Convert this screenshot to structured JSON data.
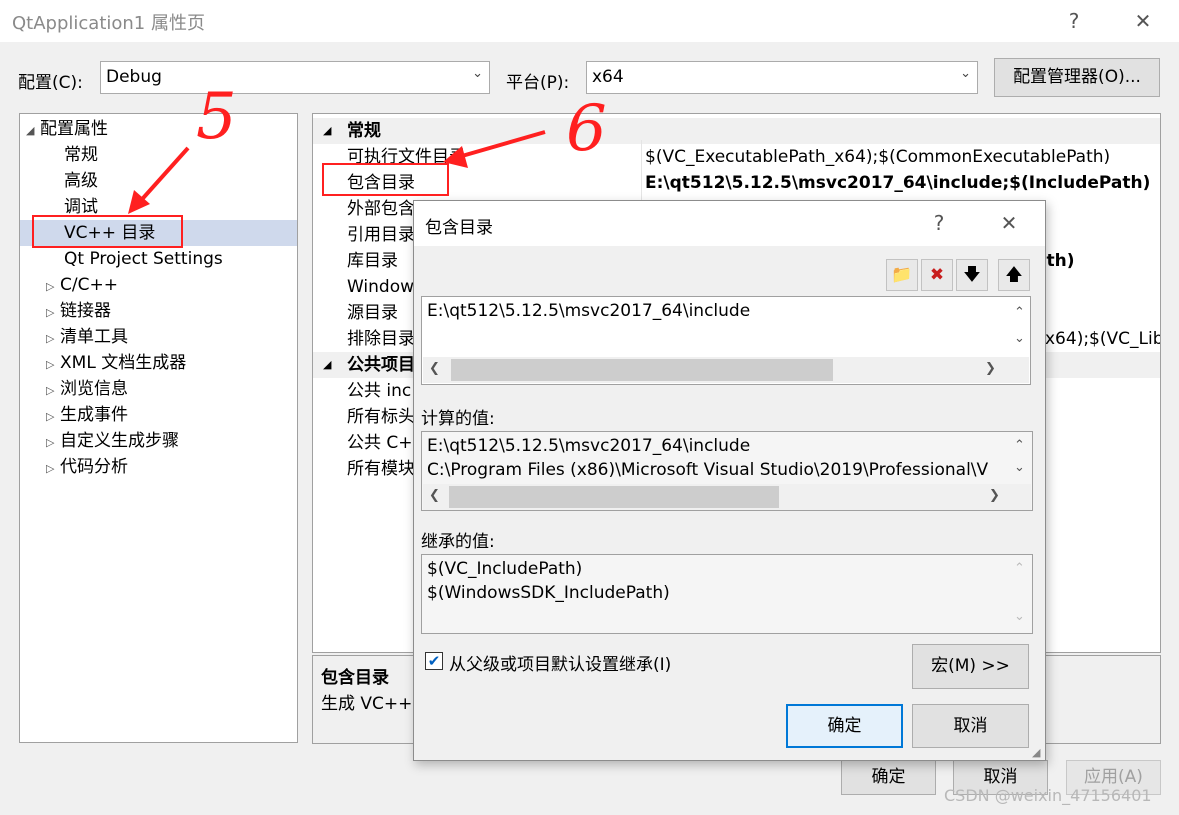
{
  "window": {
    "title": "QtApplication1 属性页",
    "help": "?",
    "close": "✕"
  },
  "config": {
    "label": "配置(C):",
    "value": "Debug",
    "platform_label": "平台(P):",
    "platform_value": "x64",
    "manager_button": "配置管理器(O)..."
  },
  "tree": {
    "root": "配置属性",
    "items": [
      {
        "label": "常规"
      },
      {
        "label": "高级"
      },
      {
        "label": "调试"
      },
      {
        "label": "VC++ 目录"
      },
      {
        "label": "Qt Project Settings"
      },
      {
        "label": "C/C++"
      },
      {
        "label": "链接器"
      },
      {
        "label": "清单工具"
      },
      {
        "label": "XML 文档生成器"
      },
      {
        "label": "浏览信息"
      },
      {
        "label": "生成事件"
      },
      {
        "label": "自定义生成步骤"
      },
      {
        "label": "代码分析"
      }
    ]
  },
  "grid": {
    "cat_general": "常规",
    "rows": [
      {
        "name": "可执行文件目录",
        "value": "$(VC_ExecutablePath_x64);$(CommonExecutablePath)"
      },
      {
        "name": "包含目录",
        "value": "E:\\qt512\\5.12.5\\msvc2017_64\\include;$(IncludePath)"
      },
      {
        "name": "外部包含",
        "value": ");"
      },
      {
        "name": "引用目录",
        "value": ""
      },
      {
        "name": "库目录",
        "value": "ath)"
      },
      {
        "name": "Window",
        "value": ""
      },
      {
        "name": "源目录",
        "value": ""
      },
      {
        "name": "排除目录",
        "value": "x64);$(VC_Lib"
      }
    ],
    "cat_public": "公共项目",
    "public_rows": [
      {
        "name": "公共 inc"
      },
      {
        "name": "所有标头"
      },
      {
        "name": "公共 C+"
      },
      {
        "name": "所有模块"
      }
    ]
  },
  "desc": {
    "title": "包含目录",
    "text": "生成 VC++"
  },
  "dialog": {
    "title": "包含目录",
    "help": "?",
    "close": "✕",
    "edit_value": "E:\\qt512\\5.12.5\\msvc2017_64\\include",
    "computed_label": "计算的值:",
    "computed_lines": [
      "E:\\qt512\\5.12.5\\msvc2017_64\\include",
      "C:\\Program Files (x86)\\Microsoft Visual Studio\\2019\\Professional\\V"
    ],
    "inherited_label": "继承的值:",
    "inherited_lines": [
      "$(VC_IncludePath)",
      "$(WindowsSDK_IncludePath)"
    ],
    "inherit_checkbox": "从父级或项目默认设置继承(I)",
    "inherit_checked": true,
    "macro_button": "宏(M) >>",
    "ok_button": "确定",
    "cancel_button": "取消"
  },
  "footer": {
    "ok": "确定",
    "cancel": "取消",
    "apply": "应用(A)"
  },
  "annotations": {
    "mark5": "5",
    "mark6": "6"
  },
  "watermark": "CSDN @weixin_47156401",
  "colors": {
    "annotation_red": "#ff2020",
    "selection": "#cfd9ec",
    "ok_border": "#0078d7"
  }
}
